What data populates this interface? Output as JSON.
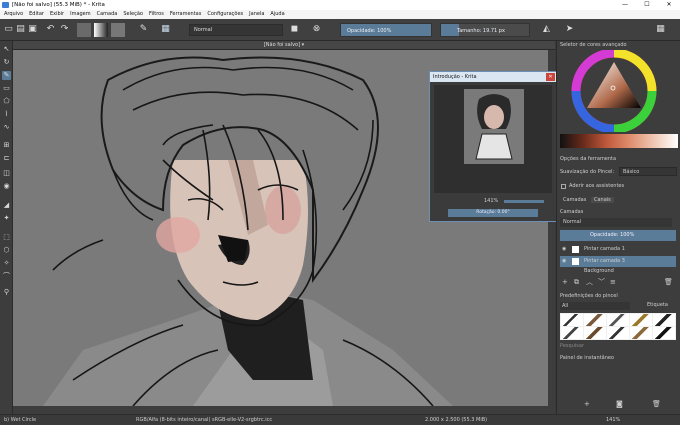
{
  "window": {
    "title": "[Não foi salvo]  (55.3 MiB)  * - Krita",
    "buttons": [
      "—",
      "☐",
      "✕"
    ]
  },
  "menu": [
    "Arquivo",
    "Editar",
    "Exibir",
    "Imagem",
    "Camada",
    "Seleção",
    "Filtros",
    "Ferramentas",
    "Configurações",
    "Janela",
    "Ajuda"
  ],
  "toolbar": {
    "blend_mode": "Normal",
    "opacity_label": "Opacidade: 100%",
    "size_label": "Tamanho: 19.71 px"
  },
  "doc_tab": "[Não foi salvo]  ▾",
  "overview": {
    "title": "Introdução - Krita",
    "zoom": "141%",
    "rotation": "Rotação: 0.00°"
  },
  "docker": {
    "color_title": "Seletor de cores avançado",
    "tool_options_title": "Opções da ferramenta",
    "smoothing_label": "Suavização do Pincel:",
    "smoothing_value": "Básico",
    "snap_label": "Aderir aos assistentes",
    "tabs": [
      "Camadas",
      "Canais"
    ],
    "layers_title": "Camadas",
    "layer_mode": "Normal",
    "layer_opacity": "Opacidade: 100%",
    "layers": [
      "Pintar camada 1",
      "Pintar camada 3",
      "Background"
    ],
    "presets_title": "Predefinições do pincel",
    "preset_filter": "All",
    "preset_tag": "Etiqueta",
    "search_placeholder": "Pesquisar",
    "snapshot_title": "Painel de instantâneo"
  },
  "status": {
    "brush": "b) Wet Circle",
    "color_model": "RGB/Alfa (8-bits inteiro/canal)  sRGB-elle-V2-srgbtrc.icc",
    "dims": "2.000 x 2.500 (55.3 MiB)",
    "zoom": "141%"
  },
  "colors": {
    "accent": "#5b7c98",
    "panel": "#3d3d3d",
    "canvas": "#7a7a7a"
  }
}
